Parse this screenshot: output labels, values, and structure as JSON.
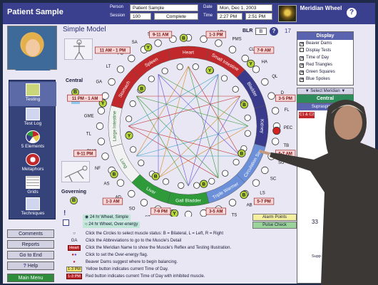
{
  "header": {
    "app_title": "Patient Sample",
    "person_label": "Person",
    "person_value": "Patient Sample",
    "session_label": "Session",
    "session_value": "100",
    "status_value": "Complete",
    "date_label": "Date",
    "date_value": "Mon, Dec 1, 2003",
    "time_label": "Time",
    "time_start": "2:27 PM",
    "time_end": "2:51 PM",
    "brand": "Meridian Wheel",
    "help_glyph": "?"
  },
  "model_title": "Simple Model",
  "central_label": "Central",
  "governing_label": "Governing",
  "blr": {
    "label": "BLR",
    "value": "B",
    "help": "?",
    "count": "17"
  },
  "nav": [
    {
      "label": "Testing",
      "icon": "testing-icon"
    },
    {
      "label": "Test Log",
      "icon": "test-log-icon"
    },
    {
      "label": "5 Elements",
      "icon": "five-elements-icon"
    },
    {
      "label": "Metaphors",
      "icon": "metaphors-icon"
    },
    {
      "label": "Grids",
      "icon": "grids-icon"
    },
    {
      "label": "Techniques",
      "icon": "techniques-icon"
    }
  ],
  "wheel": {
    "segments": [
      {
        "name": "Heart",
        "color": "#c0282c"
      },
      {
        "name": "Small Intestine",
        "color": "#c0282c"
      },
      {
        "name": "Bladder",
        "color": "#3a3a8c"
      },
      {
        "name": "Kidney",
        "color": "#3a3a8c"
      },
      {
        "name": "Circulation Sex",
        "color": "#6b8fd8"
      },
      {
        "name": "Triple Warmer",
        "color": "#6b8fd8"
      },
      {
        "name": "Gall Bladder",
        "color": "#2e9a3a"
      },
      {
        "name": "Liver",
        "color": "#2e9a3a"
      },
      {
        "name": "Lung",
        "color": "#f2f2f2"
      },
      {
        "name": "Large Intestine",
        "color": "#f2f2f2"
      },
      {
        "name": "Stomach",
        "color": "#c0282c"
      },
      {
        "name": "Spleen",
        "color": "#c0282c"
      }
    ],
    "time_labels": [
      "11 AM - 1 PM",
      "9-11 AM",
      "1-3 PM",
      "7-9 AM",
      "3-5 PM",
      "5-7 AM",
      "5-7 PM",
      "3-5 AM",
      "7-9 PM",
      "1-3 AM",
      "9-11 PM",
      "11 PM - 1 AM"
    ],
    "ring_labels": [
      "OP",
      "TR",
      "MT",
      "LD",
      "PMS",
      "CL",
      "HA",
      "QL",
      "D",
      "FL",
      "PEC",
      "TB",
      "SU",
      "SC",
      "LS",
      "AB",
      "TS",
      "SP",
      "UT",
      "PS",
      "GA",
      "ST",
      "SO",
      "AD",
      "AS",
      "NF",
      "PMC",
      "TL",
      "GME",
      "GM",
      "GA",
      "LT",
      "PO",
      "SA",
      "SA"
    ],
    "markers": [
      "B",
      "Y",
      "Y",
      "B",
      "R",
      "B",
      "B",
      "B",
      "Y",
      "B",
      "B",
      "Y",
      "Y",
      "B",
      "Y"
    ]
  },
  "display": {
    "title": "Display",
    "options": [
      {
        "label": "Beaver Dams",
        "checked": true
      },
      {
        "label": "Display Tests",
        "checked": false
      },
      {
        "label": "Time of Day",
        "checked": true
      },
      {
        "label": "Red Triangles",
        "checked": true
      },
      {
        "label": "Green Squares",
        "checked": true
      },
      {
        "label": "Blue Spokes",
        "checked": true
      }
    ]
  },
  "select_meridian": "▼ Select Meridian ▼",
  "central_bar": "Central",
  "muscle_panel": {
    "title": "Supraspinatus",
    "tag": "C1 & C2",
    "count": "33",
    "supp_label": "Supp Cent"
  },
  "hour_options": [
    {
      "label": "24 hr Wheel, Simple"
    },
    {
      "label": "24 hr Wheel, Over-energy"
    }
  ],
  "alarm_points": "Alarm Points",
  "pulse_check": "Pulse Check",
  "left_buttons": {
    "comments": "Comments",
    "reports": "Reports",
    "go_to_end": "Go to End",
    "help": "Help",
    "main_menu": "Main Menu"
  },
  "instructions": [
    {
      "key": "",
      "text": "Click the Circles to select muscle status: B = Bilateral, L = Left, R = Right"
    },
    {
      "key": "GA",
      "text": "Click the Abbreviations to go to the Muscle's Detail"
    },
    {
      "key": "Heart",
      "text": "Click the Meridian Name to show the Muscle's Reflex and Testing Illustration."
    },
    {
      "key": "",
      "text": "Click to set the Over-energy flag."
    },
    {
      "key": "",
      "text": "Beaver Dams suggest where to begin balancing."
    },
    {
      "key": "1-3 PM",
      "text": "Yellow button indicates current Time of Day."
    },
    {
      "key": "1-3 PM",
      "text": "Red button indicates current Time of Day with inhibited muscle."
    }
  ]
}
